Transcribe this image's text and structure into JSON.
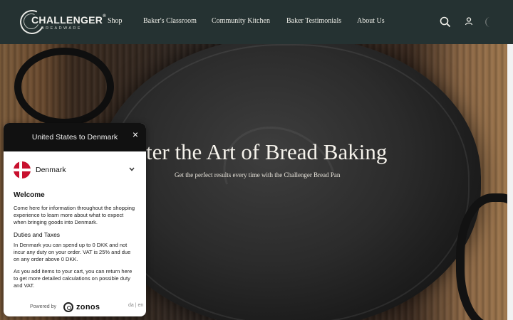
{
  "brand": {
    "name": "CHALLENGER",
    "reg": "®",
    "sub": "BREADWARE"
  },
  "nav": {
    "items": [
      "Shop",
      "Baker's Classroom",
      "Community Kitchen",
      "Baker Testimonials",
      "About Us"
    ]
  },
  "header_icons": [
    "search-icon",
    "account-icon",
    "theme-toggle-icon"
  ],
  "hero": {
    "title": "ter the Art of Bread Baking",
    "subtitle": "Get the perfect results every time with the Challenger Bread Pan"
  },
  "modal": {
    "title": "United States to Denmark",
    "close": "×",
    "country": "Denmark",
    "welcome_heading": "Welcome",
    "welcome_text": "Come here for information throughout the shopping experience to learn more about what to expect when bringing goods into Denmark.",
    "duties_heading": "Duties and Taxes",
    "duties_text": "In Denmark you can spend up to 0 DKK and not incur any duty on your order. VAT is 25% and due on any order above 0 DKK.",
    "cart_text": "As you add items to your cart, you can return here to get more detailed calculations on possible duty and VAT.",
    "powered_by": "Powered by",
    "provider": "zonos",
    "lang": "da | en"
  },
  "colors": {
    "header_bg": "#253232",
    "modal_head_bg": "#111111",
    "flag_red": "#c8102e"
  }
}
